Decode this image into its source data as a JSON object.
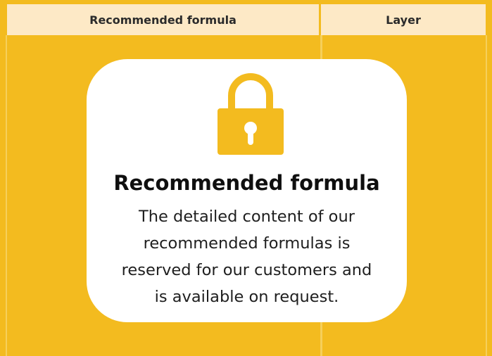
{
  "table": {
    "headers": {
      "formula": "Recommended formula",
      "layer": "Layer"
    }
  },
  "lock_panel": {
    "icon": "lock-icon",
    "title": "Recommended formula",
    "lines": [
      "The detailed content of our",
      "recommended formulas is",
      "reserved for our customers and",
      "is available on request."
    ]
  },
  "colors": {
    "background": "#f3bb1f",
    "header_bg": "#fde9c6",
    "card_bg": "#ffffff",
    "lock": "#f3bb1f"
  }
}
